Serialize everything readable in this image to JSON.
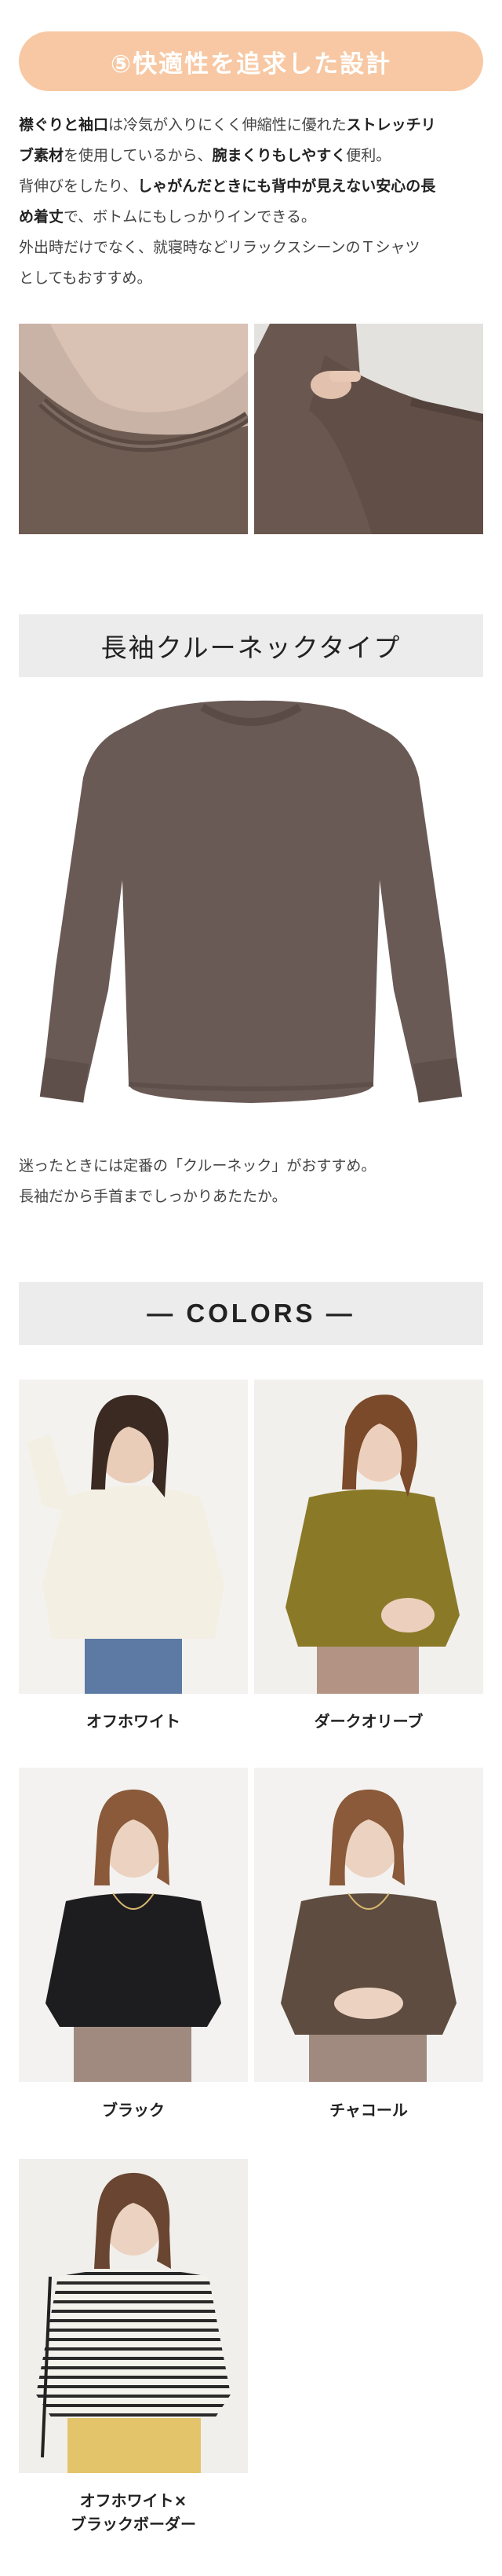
{
  "feature": {
    "heading": "⑤快適性を追求した設計",
    "intro": {
      "line1_bold": "襟ぐりと袖口",
      "line1_mid": "は冷気が入りにくく伸縮性に優れた",
      "line1_bold2": "ストレッチリ",
      "line2_bold": "ブ素材",
      "line2_mid": "を使用しているから、",
      "line2_bold2": "腕まくりもしやすく",
      "line2_end": "便利。",
      "line3_pre": "背伸びをしたり、",
      "line3_bold": "しゃがんだときにも背中が見えない安心の長",
      "line4_bold": "め着丈",
      "line4_end": "で、ボトムにもしっかりインできる。",
      "line5": "外出時だけでなく、就寝時などリラックスシーンのＴシャツ",
      "line6": "としてもおすすめ。"
    }
  },
  "product": {
    "title": "長袖クルーネックタイプ",
    "desc_line1": "迷ったときには定番の「クルーネック」がおすすめ。",
    "desc_line2": "長袖だから手首までしっかりあたたか。"
  },
  "colors": {
    "heading": "— COLORS —",
    "items": [
      {
        "label": "オフホワイト",
        "color": "#f3efe3"
      },
      {
        "label": "ダークオリーブ",
        "color": "#8a7a28"
      },
      {
        "label": "ブラック",
        "color": "#1d1d1f"
      },
      {
        "label": "チャコール",
        "color": "#5e4c40"
      },
      {
        "label_line1": "オフホワイト×",
        "label_line2": "ブラックボーダー",
        "color": "#f4f2ec"
      }
    ]
  }
}
